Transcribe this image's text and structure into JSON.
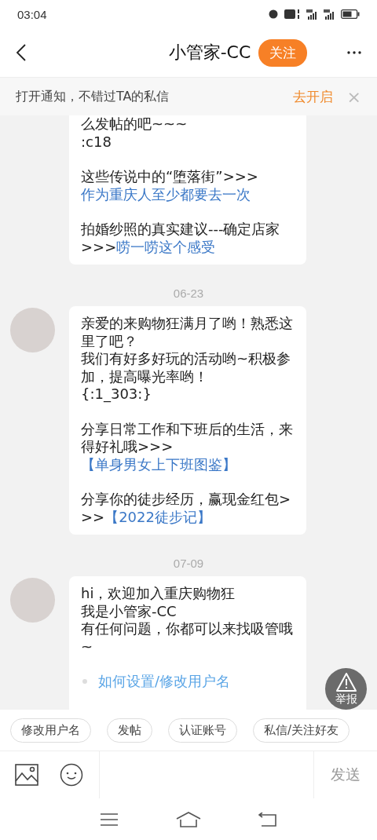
{
  "status_bar": {
    "time": "03:04"
  },
  "header": {
    "title": "小管家-CC",
    "follow_button": "关注"
  },
  "notice": {
    "text": "打开通知，不错过TA的私信",
    "action": "去开启",
    "close": "×"
  },
  "messages": [
    {
      "avatar": false,
      "cut_top": true,
      "cut_bottom": false,
      "blocks": [
        {
          "kind": "text",
          "lines": [
            [
              {
                "text": "么发帖的吧~~~",
                "link": false
              }
            ],
            [
              {
                "text": ":c18",
                "link": false
              }
            ]
          ]
        },
        {
          "kind": "text",
          "lines": [
            [
              {
                "text": "这些传说中的“堕落街”>>>",
                "link": false
              },
              {
                "text": "作为重庆人至少都要去一次",
                "link": true
              }
            ]
          ]
        },
        {
          "kind": "text",
          "lines": [
            [
              {
                "text": "拍婚纱照的真实建议---确定店家 >>>",
                "link": false
              },
              {
                "text": "唠一唠这个感受",
                "link": true
              }
            ]
          ]
        }
      ]
    },
    {
      "date": "06-23",
      "avatar": true,
      "cut_top": false,
      "cut_bottom": false,
      "blocks": [
        {
          "kind": "text",
          "lines": [
            [
              {
                "text": "亲爱的来购物狂满月了哟！熟悉这里了吧？",
                "link": false
              }
            ],
            [
              {
                "text": "我们有好多好玩的活动哟~积极参加，提高曝光率哟！",
                "link": false
              }
            ],
            [
              {
                "text": "{:1_303:}",
                "link": false
              }
            ]
          ]
        },
        {
          "kind": "text",
          "lines": [
            [
              {
                "text": "分享日常工作和下班后的生活，来得好礼哦>>>",
                "link": false
              },
              {
                "text": "【单身男女上下班图鉴】",
                "link": true
              }
            ]
          ]
        },
        {
          "kind": "text",
          "lines": [
            [
              {
                "text": "分享你的徒步经历，赢现金红包>>>",
                "link": false
              },
              {
                "text": "【2022徒步记】",
                "link": true
              }
            ]
          ]
        }
      ]
    },
    {
      "date": "07-09",
      "avatar": true,
      "cut_top": false,
      "cut_bottom": true,
      "blocks": [
        {
          "kind": "text",
          "lines": [
            [
              {
                "text": "hi，欢迎加入重庆购物狂",
                "link": false
              }
            ],
            [
              {
                "text": "我是小管家-CC",
                "link": false
              }
            ],
            [
              {
                "text": "有任何问题，你都可以来找吸管哦~",
                "link": false
              }
            ]
          ]
        },
        {
          "kind": "bullet",
          "lines": [
            [
              {
                "text": "如何设置/修改用户名",
                "link": true
              }
            ]
          ]
        }
      ]
    }
  ],
  "report_button": "举报",
  "quick_replies": [
    "修改用户名",
    "发帖",
    "认证账号",
    "私信/关注好友"
  ],
  "composer": {
    "send_button": "发送"
  }
}
